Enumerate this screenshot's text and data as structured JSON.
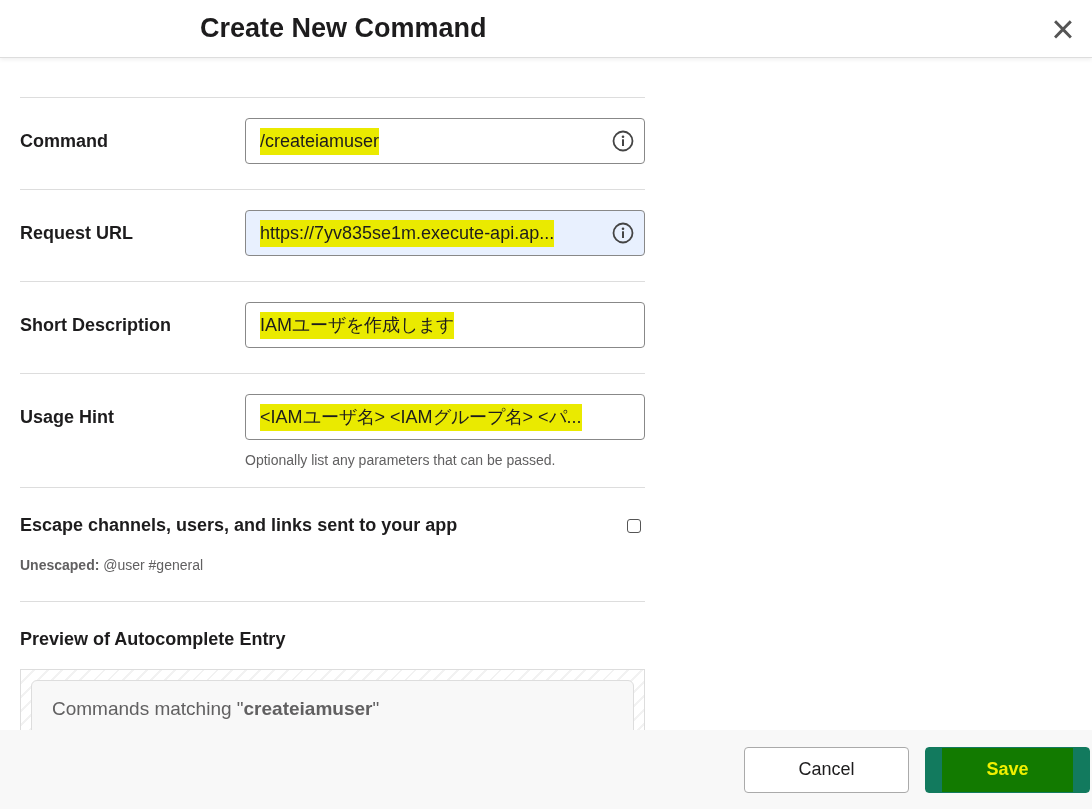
{
  "dialog": {
    "title": "Create New Command",
    "close": "×"
  },
  "fields": [
    {
      "label": "Command",
      "value": "/createiamuser",
      "info": true,
      "autofilled": false,
      "highlighted": true
    },
    {
      "label": "Request URL",
      "value": "https://7yv835se1m.execute-api.ap...",
      "info": true,
      "autofilled": true,
      "highlighted": true
    },
    {
      "label": "Short Description",
      "value": "IAMユーザを作成します",
      "info": false,
      "autofilled": false,
      "highlighted": true
    },
    {
      "label": "Usage Hint",
      "value": "<IAMユーザ名> <IAMグループ名> <パ...",
      "info": false,
      "autofilled": false,
      "highlighted": true,
      "help": "Optionally list any parameters that can be passed."
    }
  ],
  "escape": {
    "label": "Escape channels, users, and links sent to your app",
    "checked": false,
    "note": "**Unescaped:** @user #general"
  },
  "preview": {
    "heading": "Preview of Autocomplete Entry",
    "text": "Commands matching \"**createiamuser**\""
  },
  "buttons": [
    {
      "label": "Cancel",
      "kind": "secondary",
      "highlighted": false
    },
    {
      "label": "Save",
      "kind": "primary",
      "highlighted": true
    }
  ]
}
